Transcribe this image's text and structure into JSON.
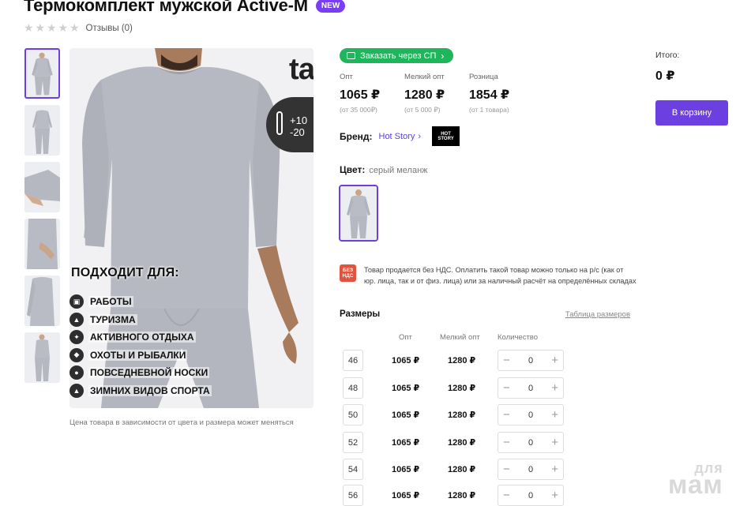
{
  "product": {
    "title": "Термокомплект мужской Active-M",
    "badge": "NEW",
    "reviews": "Отзывы (0)",
    "stars": 0
  },
  "gallery": {
    "suits_title": "ПОДХОДИТ ДЛЯ:",
    "uses": [
      "РАБОТЫ",
      "ТУРИЗМА",
      "АКТИВНОГО ОТДЫХА",
      "ОХОТЫ И РЫБАЛКИ",
      "ПОВСЕДНЕВНОЙ НОСКИ",
      "ЗИМНИХ ВИДОВ СПОРТА"
    ],
    "temp_plus": "+10",
    "temp_minus": "-20",
    "caption": "Цена товара в зависимости от цвета и размера может меняться"
  },
  "sp_button": "Заказать через СП",
  "prices": [
    {
      "label": "Опт",
      "value": "1065 ₽",
      "note": "(от 35 000₽)"
    },
    {
      "label": "Мелкий опт",
      "value": "1280 ₽",
      "note": "(от 5 000 ₽)"
    },
    {
      "label": "Розница",
      "value": "1854 ₽",
      "note": "(от 1 товара)"
    }
  ],
  "brand": {
    "key": "Бренд:",
    "name": "Hot Story"
  },
  "color": {
    "key": "Цвет:",
    "value": "серый меланж"
  },
  "vat": {
    "icon": "БЕЗ НДС",
    "text": "Товар продается без НДС. Оплатить такой товар можно только на р/с (как от юр. лица, так и от физ. лица) или за наличный расчёт на определённых складах"
  },
  "sizes": {
    "title": "Размеры",
    "chart_link": "Таблица размеров",
    "headers": {
      "opt": "Опт",
      "small": "Мелкий опт",
      "qty": "Количество"
    },
    "rows": [
      {
        "size": "46",
        "opt": "1065 ₽",
        "small": "1280 ₽",
        "qty": "0"
      },
      {
        "size": "48",
        "opt": "1065 ₽",
        "small": "1280 ₽",
        "qty": "0"
      },
      {
        "size": "50",
        "opt": "1065 ₽",
        "small": "1280 ₽",
        "qty": "0"
      },
      {
        "size": "52",
        "opt": "1065 ₽",
        "small": "1280 ₽",
        "qty": "0"
      },
      {
        "size": "54",
        "opt": "1065 ₽",
        "small": "1280 ₽",
        "qty": "0"
      },
      {
        "size": "56",
        "opt": "1065 ₽",
        "small": "1280 ₽",
        "qty": "0"
      }
    ]
  },
  "total": {
    "label": "Итого:",
    "value": "0 ₽"
  },
  "cart_button": "В корзину",
  "watermark": {
    "top": "для",
    "bottom": "мам"
  },
  "colors": {
    "accent": "#6b3fe0",
    "green": "#1fb55b",
    "vat_red": "#e2533e"
  }
}
